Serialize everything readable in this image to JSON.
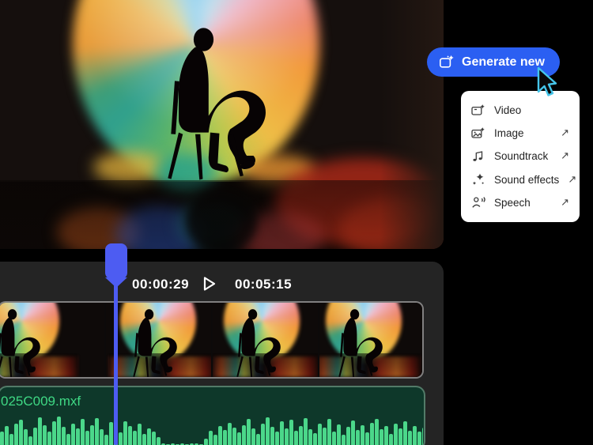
{
  "colors": {
    "page_background": "#000000",
    "button_blue": "#2b5ff2",
    "playhead_blue": "#4d5cf2",
    "panel_gray": "#242424",
    "audio_clip_green": "#0e382a",
    "audio_text_green": "#3fd884",
    "waveform_green": "#4bd78a",
    "cursor_outline_cyan": "#45c5ea"
  },
  "generate": {
    "label": "Generate new",
    "icon": "generate-sparkle-icon"
  },
  "menu": {
    "external_arrow": "↗",
    "items": [
      {
        "label": "Video",
        "icon": "video-generate-icon",
        "external": false
      },
      {
        "label": "Image",
        "icon": "image-generate-icon",
        "external": true
      },
      {
        "label": "Soundtrack",
        "icon": "soundtrack-icon",
        "external": true
      },
      {
        "label": "Sound effects",
        "icon": "sound-effects-icon",
        "external": true
      },
      {
        "label": "Speech",
        "icon": "speech-icon",
        "external": true
      }
    ]
  },
  "timeline": {
    "current_timecode": "00:00:29",
    "duration_timecode": "00:05:15",
    "video_track": {
      "thumbnails": [
        {
          "shift": -34
        },
        {
          "shift": 4
        },
        {
          "shift": 0
        },
        {
          "shift": -6
        }
      ]
    },
    "audio_track": {
      "filename": "025C009.mxf",
      "waveform": [
        0.45,
        0.62,
        0.38,
        0.7,
        0.85,
        0.52,
        0.3,
        0.58,
        0.92,
        0.66,
        0.44,
        0.78,
        0.95,
        0.6,
        0.38,
        0.72,
        0.55,
        0.88,
        0.47,
        0.65,
        0.9,
        0.52,
        0.34,
        0.76,
        0.58,
        0.42,
        0.8,
        0.62,
        0.48,
        0.7,
        0.36,
        0.56,
        0.44,
        0.25,
        0.05,
        0.03,
        0.04,
        0.02,
        0.04,
        0.03,
        0.05,
        0.04,
        0.03,
        0.22,
        0.48,
        0.35,
        0.62,
        0.5,
        0.74,
        0.58,
        0.42,
        0.66,
        0.88,
        0.54,
        0.38,
        0.7,
        0.92,
        0.6,
        0.46,
        0.78,
        0.56,
        0.84,
        0.48,
        0.64,
        0.9,
        0.52,
        0.4,
        0.72,
        0.58,
        0.86,
        0.46,
        0.68,
        0.34,
        0.6,
        0.82,
        0.5,
        0.66,
        0.42,
        0.74,
        0.88,
        0.52,
        0.64,
        0.38,
        0.7,
        0.56,
        0.8,
        0.48,
        0.62,
        0.44,
        0.58
      ]
    }
  }
}
